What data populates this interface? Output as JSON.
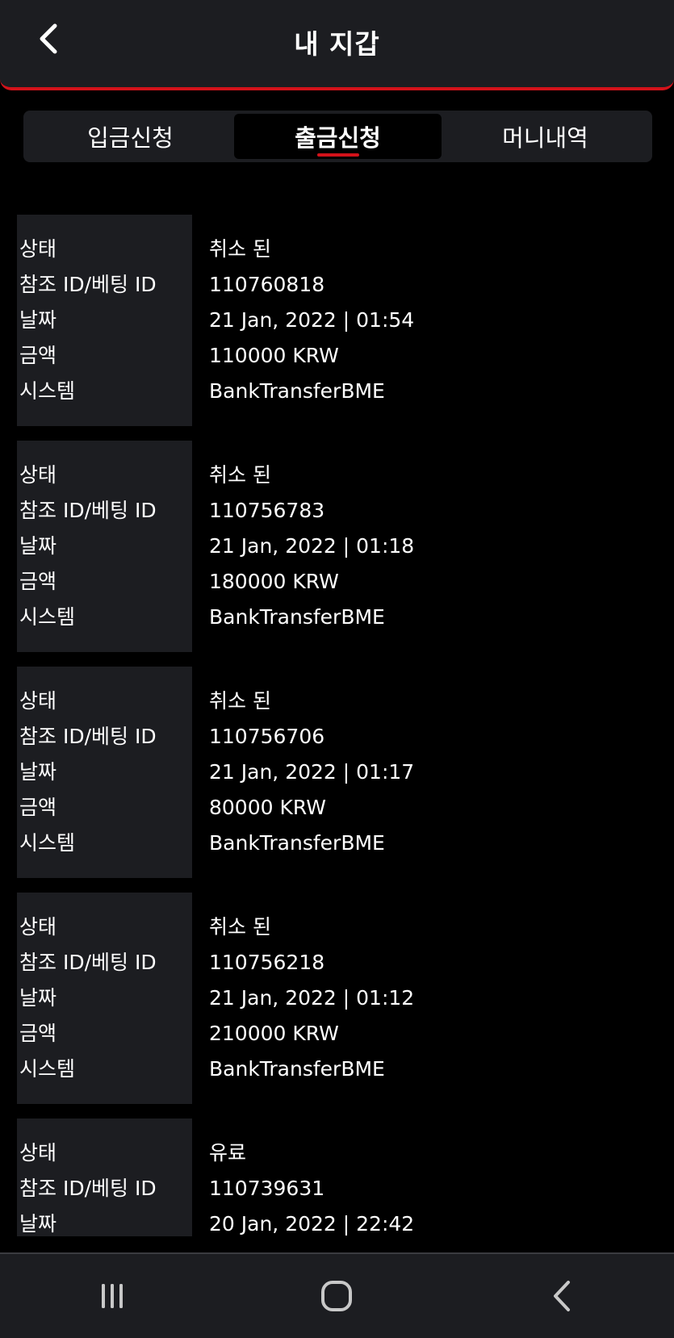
{
  "header": {
    "title": "내 지갑",
    "back_icon": "chevron-left-icon"
  },
  "tabs": [
    {
      "label": "입금신청",
      "active": false
    },
    {
      "label": "출금신청",
      "active": true
    },
    {
      "label": "머니내역",
      "active": false
    }
  ],
  "colors": {
    "accent": "#d3121a",
    "panel": "#1c1d21",
    "background": "#000000"
  },
  "labels": {
    "status": "상태",
    "ref_id": "참조 ID/베팅 ID",
    "date": "날짜",
    "amount": "금액",
    "system": "시스템"
  },
  "records": [
    {
      "status": "취소 된",
      "ref_id": "110760818",
      "date": "21 Jan, 2022 | 01:54",
      "amount": "110000 KRW",
      "system": "BankTransferBME"
    },
    {
      "status": "취소 된",
      "ref_id": "110756783",
      "date": "21 Jan, 2022 | 01:18",
      "amount": "180000 KRW",
      "system": "BankTransferBME"
    },
    {
      "status": "취소 된",
      "ref_id": "110756706",
      "date": "21 Jan, 2022 | 01:17",
      "amount": "80000 KRW",
      "system": "BankTransferBME"
    },
    {
      "status": "취소 된",
      "ref_id": "110756218",
      "date": "21 Jan, 2022 | 01:12",
      "amount": "210000 KRW",
      "system": "BankTransferBME"
    },
    {
      "status": "유료",
      "ref_id": "110739631",
      "date": "20 Jan, 2022 | 22:42",
      "amount": "",
      "system": ""
    }
  ],
  "navbar": {
    "icons": [
      "recent-apps-icon",
      "home-icon",
      "back-icon"
    ]
  }
}
